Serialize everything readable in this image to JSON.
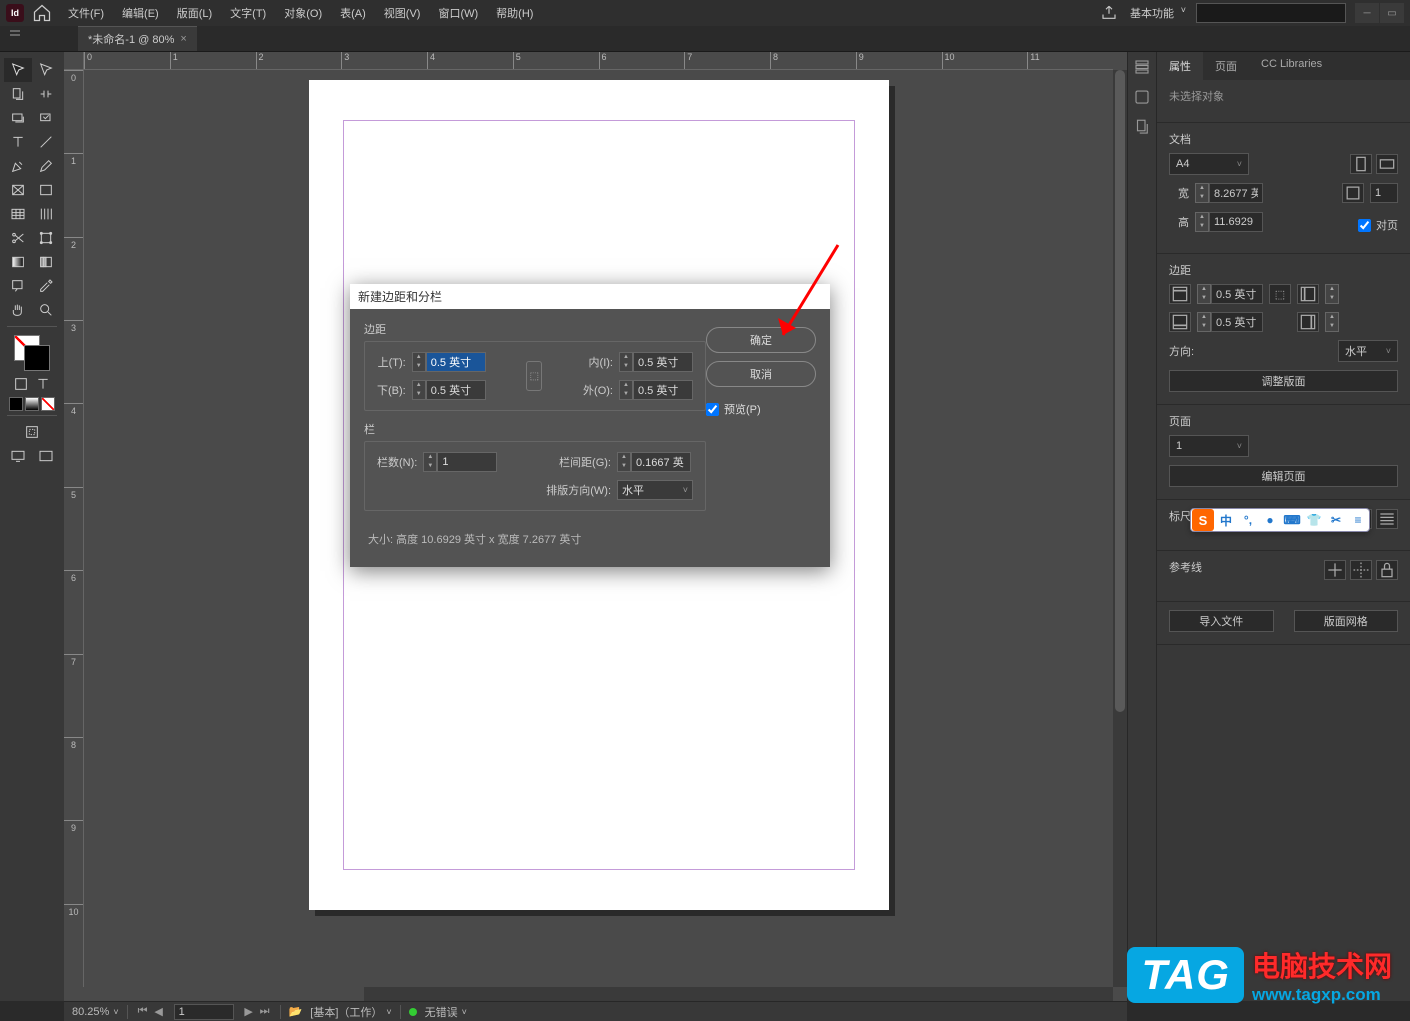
{
  "menubar": {
    "app_badge": "Id",
    "items": [
      "文件(F)",
      "编辑(E)",
      "版面(L)",
      "文字(T)",
      "对象(O)",
      "表(A)",
      "视图(V)",
      "窗口(W)",
      "帮助(H)"
    ],
    "workspace": "基本功能"
  },
  "doc_tab": {
    "title": "*未命名-1 @ 80%"
  },
  "ruler_h": [
    "0",
    "1",
    "2",
    "3",
    "4",
    "5",
    "6",
    "7",
    "8",
    "9",
    "10",
    "11"
  ],
  "ruler_v": [
    "0",
    "1",
    "2",
    "3",
    "4",
    "5",
    "6",
    "7",
    "8",
    "9",
    "10"
  ],
  "dialog": {
    "title": "新建边距和分栏",
    "margins_label": "边距",
    "top_label": "上(T):",
    "bottom_label": "下(B):",
    "in_label": "内(I):",
    "out_label": "外(O):",
    "top_val": "0.5 英寸",
    "bottom_val": "0.5 英寸",
    "in_val": "0.5 英寸",
    "out_val": "0.5 英寸",
    "columns_label": "栏",
    "colnum_label": "栏数(N):",
    "colnum_val": "1",
    "gutter_label": "栏间距(G):",
    "gutter_val": "0.1667 英",
    "orient_label": "排版方向(W):",
    "orient_val": "水平",
    "ok": "确定",
    "cancel": "取消",
    "preview": "预览(P)",
    "size_info": "大小: 高度 10.6929 英寸 x 宽度 7.2677 英寸"
  },
  "right": {
    "tabs": [
      "属性",
      "页面",
      "CC Libraries"
    ],
    "no_selection": "未选择对象",
    "doc_section": "文档",
    "preset": "A4",
    "w_label": "宽",
    "w_val": "8.2677 英",
    "h_label": "高",
    "h_val": "11.6929",
    "units_val": "1",
    "facing": "对页",
    "margins_section": "边距",
    "m1": "0.5 英寸",
    "m2": "0.5 英寸",
    "direction_label": "方向:",
    "direction_val": "水平",
    "adjust_layout": "调整版面",
    "pages_section": "页面",
    "page_sel": "1",
    "edit_pages": "编辑页面",
    "rulers_section": "标尺和网格",
    "guides_section": "参考线",
    "import_file": "导入文件",
    "layout_grid": "版面网格"
  },
  "status": {
    "zoom": "80.25%",
    "page": "1",
    "profile": "[基本]（工作）",
    "errors": "无错误"
  },
  "ime": {
    "items": [
      "中",
      "°,",
      "●",
      "⌨",
      "👕",
      "✂",
      "≡"
    ]
  },
  "watermark": {
    "tag": "TAG",
    "line1": "电脑技术网",
    "line2": "www.tagxp.com"
  }
}
